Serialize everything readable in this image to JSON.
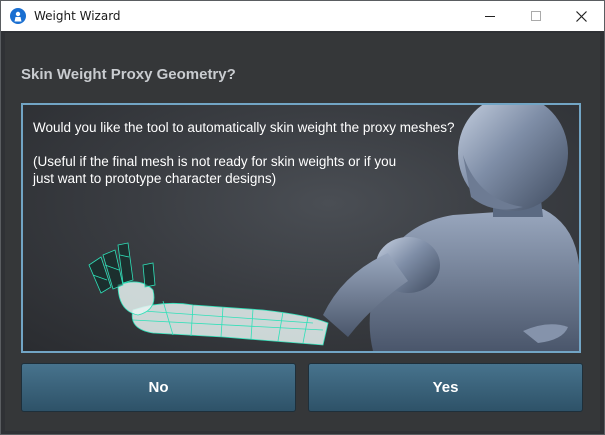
{
  "window": {
    "title": "Weight Wizard",
    "icons": [
      "app-icon",
      "minimize-icon",
      "maximize-icon",
      "close-icon"
    ]
  },
  "dialog": {
    "heading": "Skin Weight Proxy Geometry?",
    "message": "Would you like the tool to automatically skin weight the proxy meshes?\n\n(Useful if the final mesh is not ready for skin weights or if you\njust want to prototype character designs)",
    "buttons": {
      "no": "No",
      "yes": "Yes"
    }
  },
  "colors": {
    "accent_border": "#72a5c5",
    "button": "#3d6580",
    "wireframe": "#2fe0b8"
  }
}
